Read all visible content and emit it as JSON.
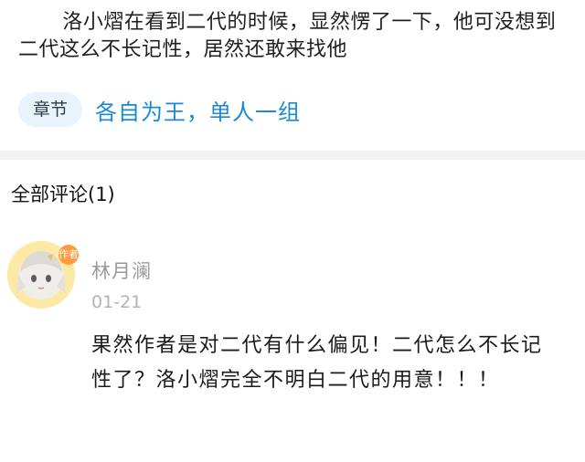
{
  "excerpt": "洛小熠在看到二代的时候，显然愣了一下，他可没想到二代这么不长记性，居然还敢来找他",
  "chapter": {
    "tag": "章节",
    "title": "各自为王，单人一组"
  },
  "comments": {
    "header": "全部评论(1)",
    "items": [
      {
        "username": "林月澜",
        "badge": "作者",
        "date": "01-21",
        "body": "果然作者是对二代有什么偏见！二代怎么不长记性了？洛小熠完全不明白二代的用意！！！"
      }
    ]
  },
  "colors": {
    "accent": "#1a8ad6",
    "tag_bg": "#e8f3fc",
    "muted": "#9a9a9a"
  }
}
